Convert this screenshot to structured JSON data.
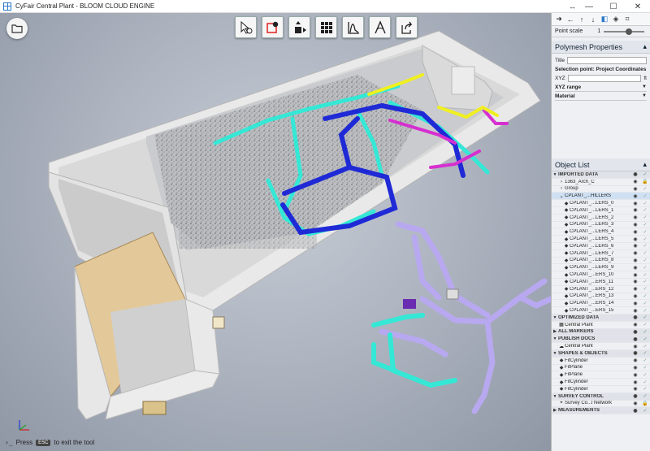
{
  "window": {
    "title": "CyFair Central Plant - BLOOM CLOUD ENGINE",
    "resize_glyph": "↔",
    "minimize": "—",
    "maximize": "☐",
    "close": "✕"
  },
  "viewport": {
    "folder_icon": "folder-icon",
    "toolbar": [
      {
        "name": "select-tool-button",
        "icon": "pointer-icon"
      },
      {
        "name": "box-tool-button",
        "icon": "clip-box-icon"
      },
      {
        "name": "move-tool-button",
        "icon": "move-icon"
      },
      {
        "name": "grid-tool-button",
        "icon": "grid-icon"
      },
      {
        "name": "profile-tool-button",
        "icon": "profile-icon"
      },
      {
        "name": "measure-tool-button",
        "icon": "measure-icon"
      },
      {
        "name": "share-tool-button",
        "icon": "share-icon"
      }
    ],
    "hint_prefix": "Press",
    "hint_key": "ESC",
    "hint_suffix": "to exit the tool",
    "prompt_glyph": "›_"
  },
  "panel": {
    "nav_icons": [
      "arrow-right-icon",
      "arrow-left-icon",
      "up-icon",
      "down-icon",
      "cube-icon",
      "perspective-icon",
      "crop-icon"
    ],
    "point_scale_label": "Point scale",
    "point_scale_value": "1",
    "point_scale_level": 0.62,
    "polymesh_title": "Polymesh Properties",
    "title_label": "Title",
    "selection_point_label": "Selection point: Project Coordinates",
    "xyz_label": "XYZ",
    "xyz_unit": "ft",
    "xyz_range_label": "XYZ range",
    "material_label": "Material",
    "object_list_title": "Object List"
  },
  "objects": [
    {
      "label": "IMPORTED DATA",
      "type": "header",
      "expanded": true,
      "lock": false
    },
    {
      "label": "1363_Arch_C",
      "type": "item",
      "indent": 1,
      "icon": "chevron",
      "lock": true
    },
    {
      "label": "Group",
      "type": "item",
      "indent": 1,
      "icon": "chevron",
      "lock": false
    },
    {
      "label": "CPLANT_...HILLERS",
      "type": "item",
      "indent": 1,
      "icon": "chevron-open",
      "selected": true,
      "lock": false
    },
    {
      "label": "CPLANT_...LERS_0",
      "type": "item",
      "indent": 2,
      "icon": "mesh",
      "lock": false
    },
    {
      "label": "CPLANT_...LERS_1",
      "type": "item",
      "indent": 2,
      "icon": "mesh",
      "lock": false
    },
    {
      "label": "CPLANT_...LERS_2",
      "type": "item",
      "indent": 2,
      "icon": "mesh",
      "lock": false
    },
    {
      "label": "CPLANT_...LERS_3",
      "type": "item",
      "indent": 2,
      "icon": "mesh",
      "lock": false
    },
    {
      "label": "CPLANT_...LERS_4",
      "type": "item",
      "indent": 2,
      "icon": "mesh",
      "lock": false
    },
    {
      "label": "CPLANT_...LERS_5",
      "type": "item",
      "indent": 2,
      "icon": "mesh",
      "lock": false
    },
    {
      "label": "CPLANT_...LERS_6",
      "type": "item",
      "indent": 2,
      "icon": "mesh",
      "lock": false
    },
    {
      "label": "CPLANT_...LERS_7",
      "type": "item",
      "indent": 2,
      "icon": "mesh",
      "lock": false
    },
    {
      "label": "CPLANT_...LERS_8",
      "type": "item",
      "indent": 2,
      "icon": "mesh",
      "lock": false
    },
    {
      "label": "CPLANT_...LERS_9",
      "type": "item",
      "indent": 2,
      "icon": "mesh",
      "lock": false
    },
    {
      "label": "CPLANT_...ERS_10",
      "type": "item",
      "indent": 2,
      "icon": "mesh",
      "lock": false
    },
    {
      "label": "CPLANT_...ERS_11",
      "type": "item",
      "indent": 2,
      "icon": "mesh",
      "lock": false
    },
    {
      "label": "CPLANT_...ERS_12",
      "type": "item",
      "indent": 2,
      "icon": "mesh",
      "lock": false
    },
    {
      "label": "CPLANT_...ERS_13",
      "type": "item",
      "indent": 2,
      "icon": "mesh",
      "lock": false
    },
    {
      "label": "CPLANT_...ERS_14",
      "type": "item",
      "indent": 2,
      "icon": "mesh",
      "lock": false
    },
    {
      "label": "CPLANT_...ERS_15",
      "type": "item",
      "indent": 2,
      "icon": "mesh",
      "lock": false
    },
    {
      "label": "OPTIMIZED DATA",
      "type": "header",
      "expanded": true,
      "lock": false
    },
    {
      "label": "Central Plant",
      "type": "item",
      "indent": 1,
      "icon": "grid",
      "lock": false
    },
    {
      "label": "ALL MARKERS",
      "type": "header",
      "expanded": false,
      "lock": false
    },
    {
      "label": "PUBLISH DOCS",
      "type": "header",
      "expanded": true,
      "lock": false
    },
    {
      "label": "Central Plant",
      "type": "item",
      "indent": 1,
      "icon": "cloud",
      "lock": false
    },
    {
      "label": "SHAPES & OBJECTS",
      "type": "header",
      "expanded": true,
      "lock": false
    },
    {
      "label": "FitCylinder",
      "type": "item",
      "indent": 1,
      "icon": "mesh",
      "lock": false
    },
    {
      "label": "FitPlane",
      "type": "item",
      "indent": 1,
      "icon": "mesh",
      "lock": false
    },
    {
      "label": "FitPlane",
      "type": "item",
      "indent": 1,
      "icon": "mesh",
      "lock": false
    },
    {
      "label": "FitCylinder",
      "type": "item",
      "indent": 1,
      "icon": "mesh",
      "lock": false
    },
    {
      "label": "FitCylinder",
      "type": "item",
      "indent": 1,
      "icon": "mesh",
      "lock": false
    },
    {
      "label": "SURVEY CONTROL",
      "type": "header",
      "expanded": true,
      "lock": false
    },
    {
      "label": "Survey Co...l Network",
      "type": "item",
      "indent": 1,
      "icon": "survey",
      "lock": true
    },
    {
      "label": "MEASUREMENTS",
      "type": "header",
      "expanded": false,
      "lock": false
    }
  ],
  "colors": {
    "accent": "#2b79c7",
    "pipe_cyan": "#35e8d6",
    "pipe_blue": "#1f2ad6",
    "pipe_magenta": "#d62fd0",
    "pipe_yellow": "#f0f020",
    "pipe_lavender": "#b8a8f0",
    "wall": "#e6e6e6",
    "room_tan": "#d9b77a"
  }
}
